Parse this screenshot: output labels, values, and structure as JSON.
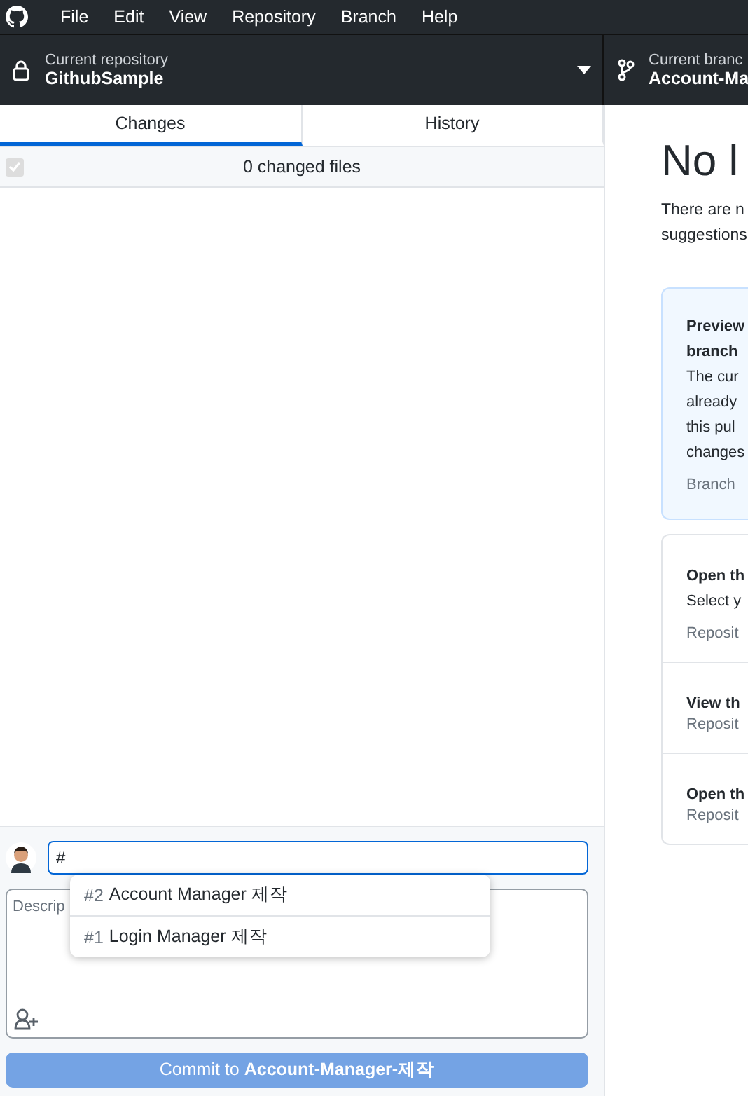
{
  "menu": [
    "File",
    "Edit",
    "View",
    "Repository",
    "Branch",
    "Help"
  ],
  "repository": {
    "label": "Current repository",
    "name": "GithubSample"
  },
  "branch": {
    "label": "Current branc",
    "name": "Account-Ma"
  },
  "tabs": [
    {
      "label": "Changes",
      "selected": true
    },
    {
      "label": "History",
      "selected": false
    }
  ],
  "changes": {
    "select_all_checked": true,
    "count_label": "0 changed files"
  },
  "commit": {
    "summary": "#",
    "description_placeholder": "Descrip",
    "button": "Commit to **Account-Manager-제작**",
    "button_disabled": true
  },
  "suggestions": [
    {
      "number": "#2",
      "title": "Account Manager 제작"
    },
    {
      "number": "#1",
      "title": "Login Manager 제작"
    }
  ],
  "no_changes": {
    "title": "No l",
    "lines": [
      "There are n",
      "suggestions"
    ],
    "highlight_card": {
      "title_lines": [
        "Preview",
        "branch"
      ],
      "body_lines": [
        "The cur",
        "already",
        "this pul",
        "changes"
      ],
      "hint": "Branch"
    },
    "actions": [
      {
        "title": "Open th",
        "body": "Select y",
        "hint": "Reposit"
      },
      {
        "title": "View th",
        "hint": "Reposit"
      },
      {
        "title": "Open th",
        "hint": "Reposit"
      }
    ]
  }
}
